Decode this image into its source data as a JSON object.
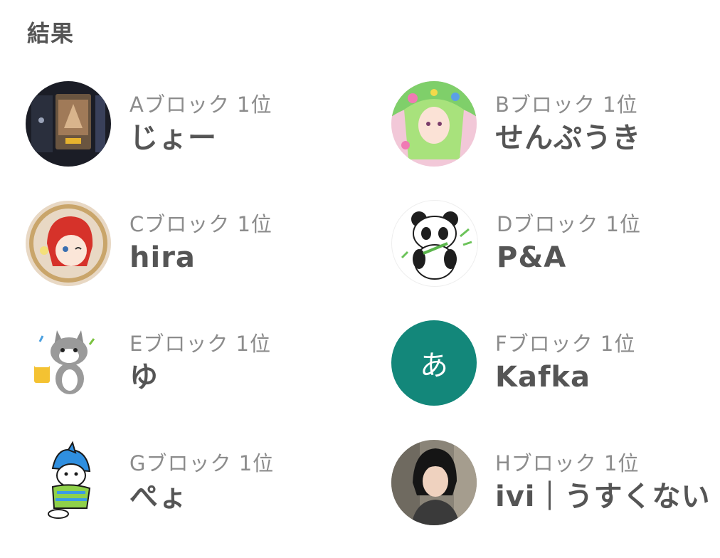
{
  "header": {
    "title": "結果"
  },
  "results": [
    {
      "block": "Aブロック 1位",
      "name": "じょー",
      "avatar_icon": "card-game-avatar-icon"
    },
    {
      "block": "Bブロック 1位",
      "name": "せんぷうき",
      "avatar_icon": "anime-girl-avatar-icon"
    },
    {
      "block": "Cブロック 1位",
      "name": "hira",
      "avatar_icon": "red-hair-character-avatar-icon"
    },
    {
      "block": "Dブロック 1位",
      "name": "P&A",
      "avatar_icon": "panda-avatar-icon"
    },
    {
      "block": "Eブロック 1位",
      "name": "ゆ",
      "avatar_icon": "cat-with-beer-avatar-icon"
    },
    {
      "block": "Fブロック 1位",
      "name": "Kafka",
      "avatar_initial": "あ",
      "avatar_color": "#13877a"
    },
    {
      "block": "Gブロック 1位",
      "name": "ぺょ",
      "avatar_icon": "shark-hood-character-avatar-icon"
    },
    {
      "block": "Hブロック 1位",
      "name": "ivi｜うすくない",
      "avatar_icon": "person-photo-avatar-icon"
    }
  ]
}
